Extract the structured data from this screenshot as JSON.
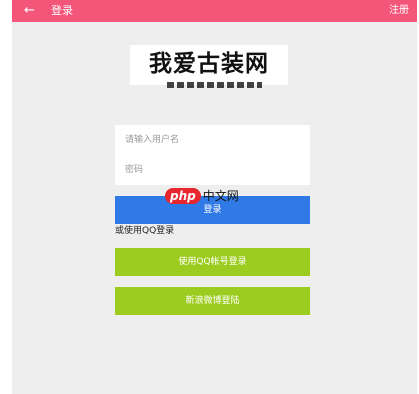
{
  "header": {
    "back_icon": "arrow-left-icon",
    "back_glyph": "←",
    "title": "登录",
    "register_label": "注册",
    "bg_color": "#f4567a"
  },
  "logo": {
    "text": "我爱古装网"
  },
  "form": {
    "username_placeholder": "请输入用户名",
    "password_placeholder": "密码",
    "login_label": "登录",
    "login_color": "#2f7ae6"
  },
  "watermark": {
    "badge": "php",
    "text": "中文网"
  },
  "alternate": {
    "label": "或使用QQ登录",
    "qq_button_label": "使用QQ帐号登录",
    "weibo_button_label": "新浪微博登陆",
    "button_color": "#9ccc1f"
  }
}
